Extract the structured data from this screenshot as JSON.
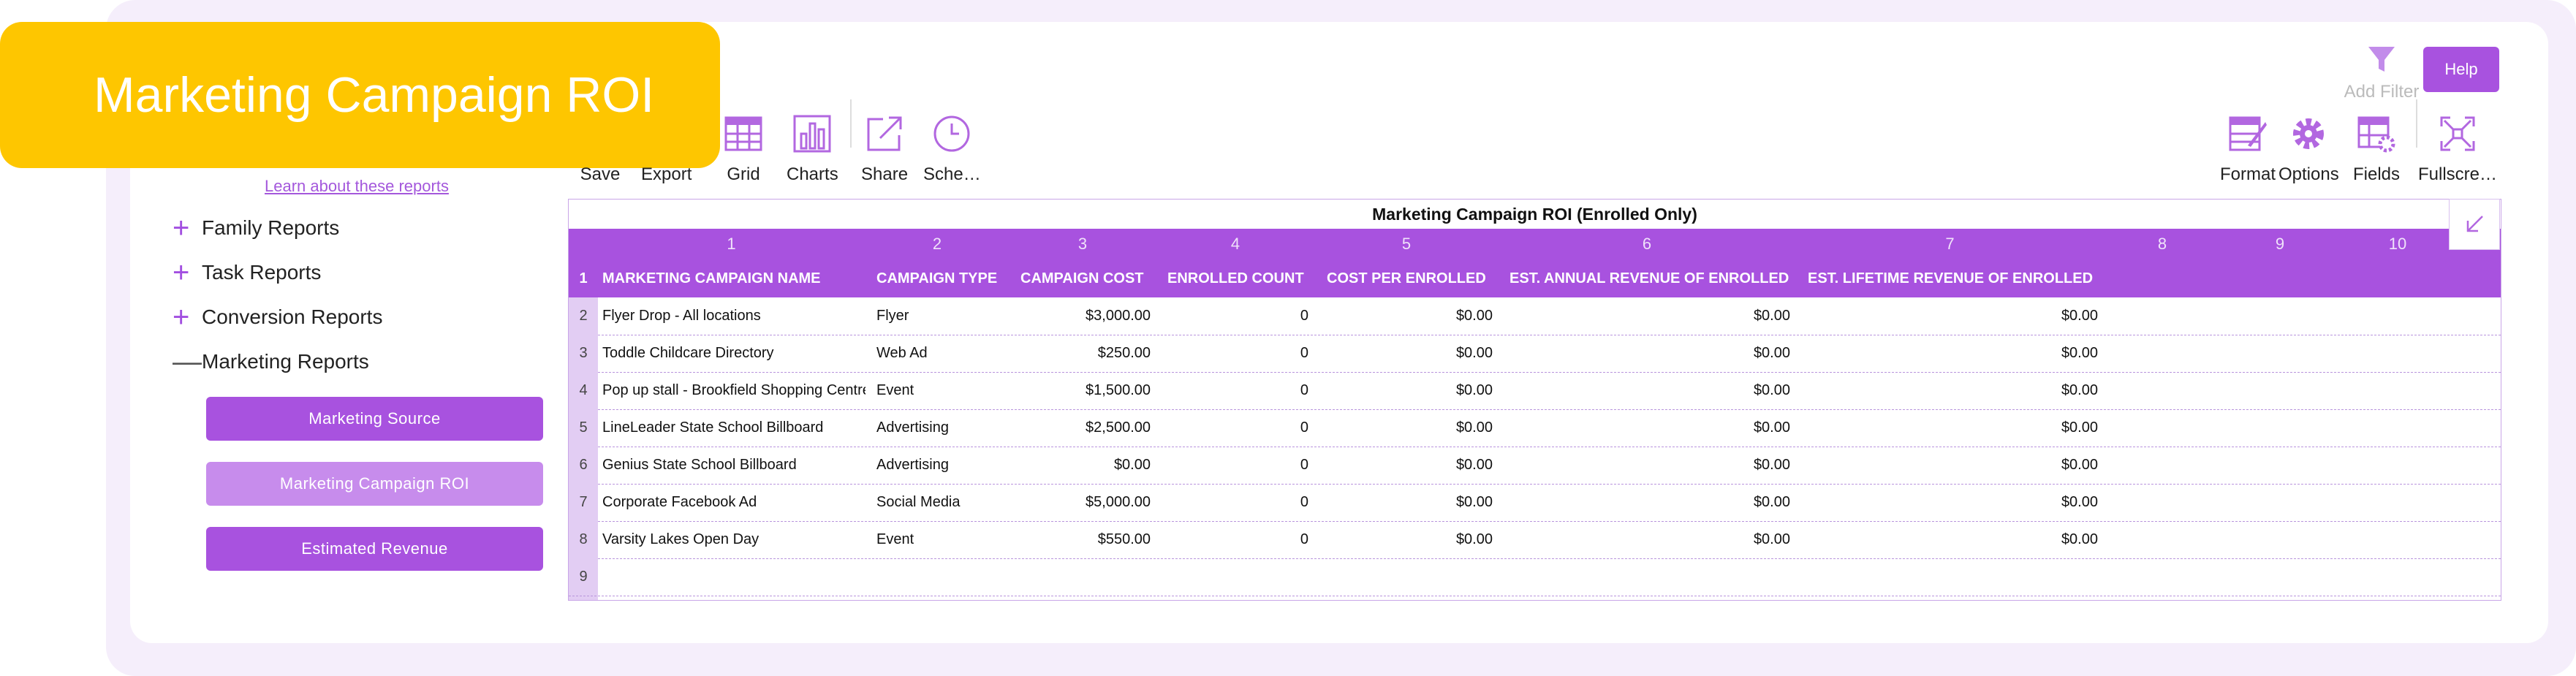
{
  "title": "Marketing Campaign ROI",
  "sidebar": {
    "learn_link": "Learn about these reports",
    "groups": [
      {
        "label": "Family Reports",
        "expanded": false
      },
      {
        "label": "Task Reports",
        "expanded": false
      },
      {
        "label": "Conversion Reports",
        "expanded": false
      },
      {
        "label": "Marketing Reports",
        "expanded": true
      }
    ],
    "reports": [
      {
        "label": "Marketing Source",
        "active": false
      },
      {
        "label": "Marketing Campaign ROI",
        "active": true
      },
      {
        "label": "Estimated Revenue",
        "active": false
      }
    ]
  },
  "toolbar": {
    "save": "Save",
    "export": "Export",
    "grid": "Grid",
    "charts": "Charts",
    "share": "Share",
    "schedule": "Sche…",
    "format": "Format",
    "options": "Options",
    "fields": "Fields",
    "fullscreen": "Fullscre…",
    "add_filter": "Add Filter",
    "help": "Help"
  },
  "grid": {
    "title": "Marketing Campaign ROI (Enrolled Only)",
    "col_numbers": [
      "1",
      "2",
      "3",
      "4",
      "5",
      "6",
      "7",
      "8",
      "9",
      "10"
    ],
    "header_row_num": "1",
    "headers": [
      "MARKETING CAMPAIGN NAME",
      "CAMPAIGN TYPE",
      "CAMPAIGN COST",
      "ENROLLED COUNT",
      "COST PER ENROLLED",
      "EST. ANNUAL REVENUE OF ENROLLED",
      "EST. LIFETIME REVENUE OF ENROLLED"
    ],
    "rows": [
      {
        "num": "2",
        "name": "Flyer Drop - All locations",
        "type": "Flyer",
        "cost": "$3,000.00",
        "enrolled": "0",
        "cpe": "$0.00",
        "annual": "$0.00",
        "lifetime": "$0.00"
      },
      {
        "num": "3",
        "name": "Toddle Childcare Directory",
        "type": "Web Ad",
        "cost": "$250.00",
        "enrolled": "0",
        "cpe": "$0.00",
        "annual": "$0.00",
        "lifetime": "$0.00"
      },
      {
        "num": "4",
        "name": "Pop up stall - Brookfield Shopping Centre",
        "type": "Event",
        "cost": "$1,500.00",
        "enrolled": "0",
        "cpe": "$0.00",
        "annual": "$0.00",
        "lifetime": "$0.00"
      },
      {
        "num": "5",
        "name": "LineLeader State School Billboard",
        "type": "Advertising",
        "cost": "$2,500.00",
        "enrolled": "0",
        "cpe": "$0.00",
        "annual": "$0.00",
        "lifetime": "$0.00"
      },
      {
        "num": "6",
        "name": "Genius State School Billboard",
        "type": "Advertising",
        "cost": "$0.00",
        "enrolled": "0",
        "cpe": "$0.00",
        "annual": "$0.00",
        "lifetime": "$0.00"
      },
      {
        "num": "7",
        "name": "Corporate Facebook Ad",
        "type": "Social Media",
        "cost": "$5,000.00",
        "enrolled": "0",
        "cpe": "$0.00",
        "annual": "$0.00",
        "lifetime": "$0.00"
      },
      {
        "num": "8",
        "name": "Varsity Lakes Open Day",
        "type": "Event",
        "cost": "$550.00",
        "enrolled": "0",
        "cpe": "$0.00",
        "annual": "$0.00",
        "lifetime": "$0.00"
      },
      {
        "num": "9",
        "name": "",
        "type": "",
        "cost": "",
        "enrolled": "",
        "cpe": "",
        "annual": "",
        "lifetime": ""
      }
    ]
  },
  "colors": {
    "accent": "#a852df",
    "accent_light": "#c78cec",
    "banner": "#fec600",
    "frame": "#f5eefb"
  }
}
